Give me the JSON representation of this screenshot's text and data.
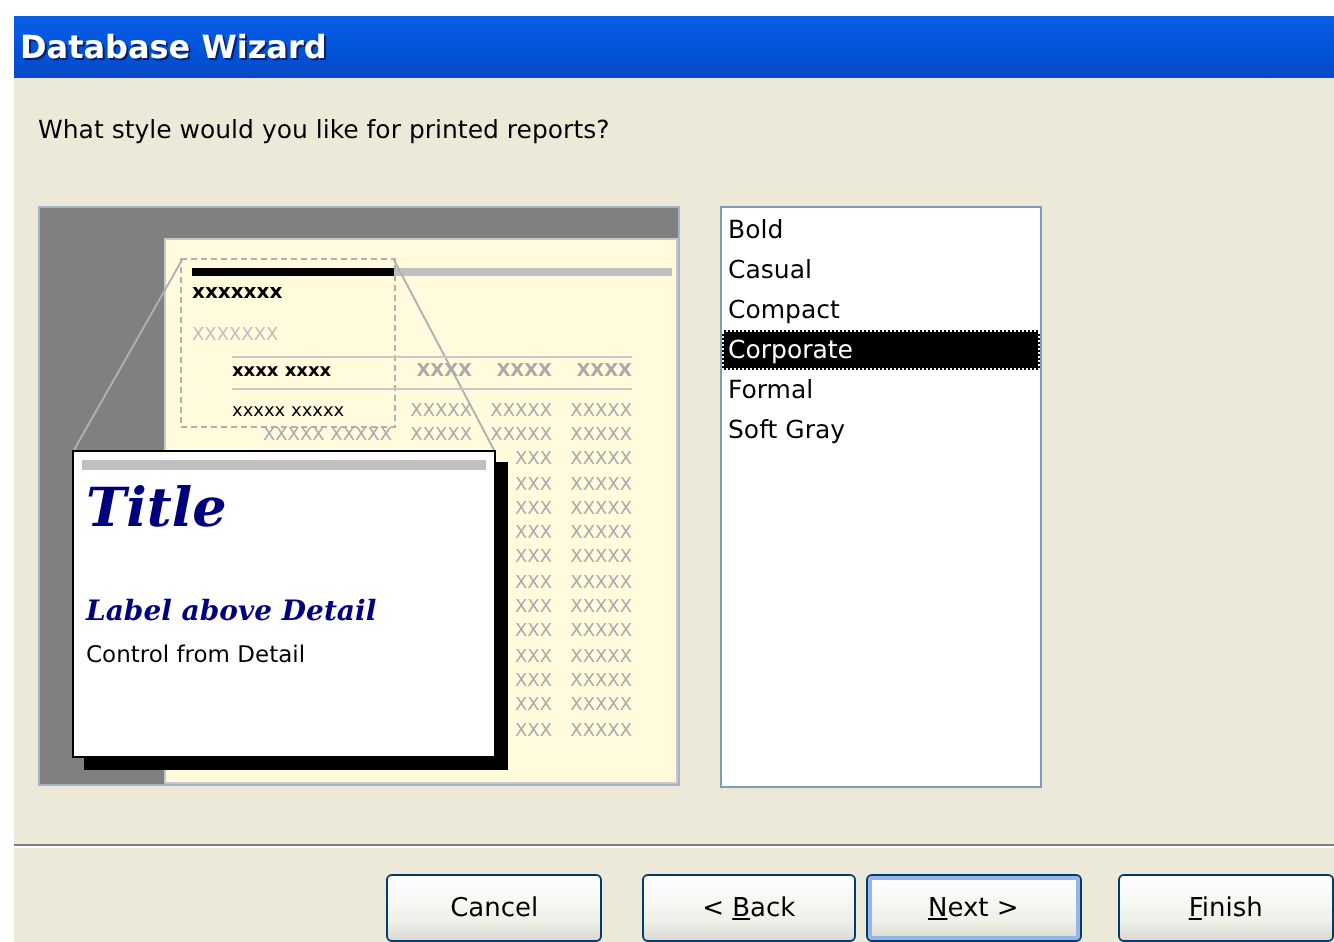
{
  "window": {
    "title": "Database Wizard"
  },
  "question": "What style would you like for printed reports?",
  "preview": {
    "header_text": "xxxxxxx",
    "group_text": "XXXXXXX",
    "column_headers": [
      {
        "text": "xxxx xxxx",
        "dark": true
      },
      {
        "text": "XXXX",
        "dark": false
      },
      {
        "text": "XXXX",
        "dark": false
      },
      {
        "text": "XXXX",
        "dark": false
      }
    ],
    "detail_rows": [
      {
        "cells": [
          {
            "text": "xxxxx xxxxx",
            "dark": true
          },
          {
            "text": "XXXXX",
            "dark": false
          },
          {
            "text": "XXXXX",
            "dark": false
          },
          {
            "text": "XXXXX",
            "dark": false
          }
        ]
      },
      {
        "cells": [
          {
            "text": "XXXXX XXXXX",
            "dark": false
          },
          {
            "text": "XXXXX",
            "dark": false
          },
          {
            "text": "XXXXX",
            "dark": false
          },
          {
            "text": "XXXXX",
            "dark": false
          }
        ]
      },
      {
        "cells": [
          {
            "text": "XXX",
            "dark": false
          },
          {
            "text": "XXXXX",
            "dark": false
          }
        ]
      },
      {
        "cells": [
          {
            "text": "XXX",
            "dark": false
          },
          {
            "text": "XXXXX",
            "dark": false
          }
        ]
      },
      {
        "cells": [
          {
            "text": "XXX",
            "dark": false
          },
          {
            "text": "XXXXX",
            "dark": false
          }
        ]
      },
      {
        "cells": [
          {
            "text": "XXX",
            "dark": false
          },
          {
            "text": "XXXXX",
            "dark": false
          }
        ]
      },
      {
        "cells": [
          {
            "text": "XXX",
            "dark": false
          },
          {
            "text": "XXXXX",
            "dark": false
          }
        ]
      },
      {
        "cells": [
          {
            "text": "XXX",
            "dark": false
          },
          {
            "text": "XXXXX",
            "dark": false
          }
        ]
      },
      {
        "cells": [
          {
            "text": "XXX",
            "dark": false
          },
          {
            "text": "XXXXX",
            "dark": false
          }
        ]
      },
      {
        "cells": [
          {
            "text": "XXX",
            "dark": false
          },
          {
            "text": "XXXXX",
            "dark": false
          }
        ]
      },
      {
        "cells": [
          {
            "text": "XXX",
            "dark": false
          },
          {
            "text": "XXXXX",
            "dark": false
          }
        ]
      },
      {
        "cells": [
          {
            "text": "XXX",
            "dark": false
          },
          {
            "text": "XXXXX",
            "dark": false
          }
        ]
      },
      {
        "cells": [
          {
            "text": "XXX",
            "dark": false
          },
          {
            "text": "XXXXX",
            "dark": false
          }
        ]
      },
      {
        "cells": [
          {
            "text": "XXX",
            "dark": false
          },
          {
            "text": "XXXXX",
            "dark": false
          }
        ]
      }
    ],
    "callout": {
      "title": "Title",
      "label": "Label above Detail",
      "control": "Control from Detail"
    }
  },
  "styles": [
    {
      "label": "Bold",
      "selected": false
    },
    {
      "label": "Casual",
      "selected": false
    },
    {
      "label": "Compact",
      "selected": false
    },
    {
      "label": "Corporate",
      "selected": true
    },
    {
      "label": "Formal",
      "selected": false
    },
    {
      "label": "Soft Gray",
      "selected": false
    }
  ],
  "buttons": [
    {
      "before": "Cancel",
      "focused": false
    },
    {
      "before": "< ",
      "key": "B",
      "after": "ack",
      "focused": false
    },
    {
      "key": "N",
      "after": "ext >",
      "focused": true
    },
    {
      "key": "F",
      "after": "inish",
      "focused": false
    }
  ]
}
